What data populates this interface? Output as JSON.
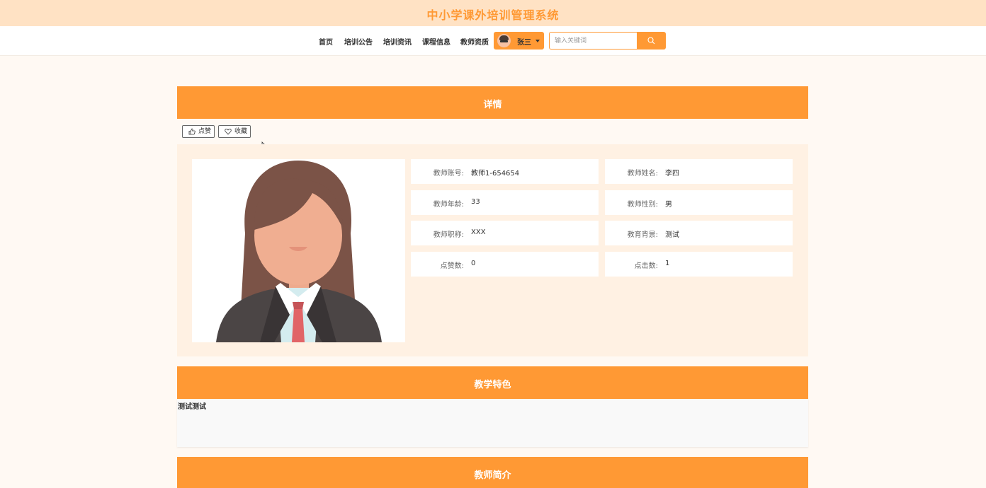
{
  "site": {
    "title": "中小学课外培训管理系统"
  },
  "nav": {
    "items": [
      {
        "label": "首页"
      },
      {
        "label": "培训公告"
      },
      {
        "label": "培训资讯"
      },
      {
        "label": "课程信息"
      },
      {
        "label": "教师资质"
      }
    ],
    "user": {
      "name": "张三"
    },
    "search": {
      "placeholder": "输入关键词"
    }
  },
  "detail": {
    "header": "详情",
    "like_label": "点赞",
    "favorite_label": "收藏",
    "fields": [
      {
        "label": "教师账号:",
        "value": "教师1-654654"
      },
      {
        "label": "教师姓名:",
        "value": "李四"
      },
      {
        "label": "教师年龄:",
        "value": "33"
      },
      {
        "label": "教师性别:",
        "value": "男"
      },
      {
        "label": "教师职称:",
        "value": "XXX"
      },
      {
        "label": "教育背景:",
        "value": "测试"
      },
      {
        "label": "点赞数:",
        "value": "0"
      },
      {
        "label": "点击数:",
        "value": "1"
      }
    ]
  },
  "features": {
    "header": "教学特色",
    "content": "测试测试"
  },
  "intro": {
    "header": "教师简介"
  },
  "colors": {
    "accent": "#ff9934",
    "banner": "#ffe2c4",
    "panel": "#fff1e3",
    "background": "#fff9f3"
  },
  "icons": {
    "like": "thumbs-up-icon",
    "favorite": "heart-icon",
    "search": "search-icon",
    "cursor": "mouse-cursor-icon"
  }
}
